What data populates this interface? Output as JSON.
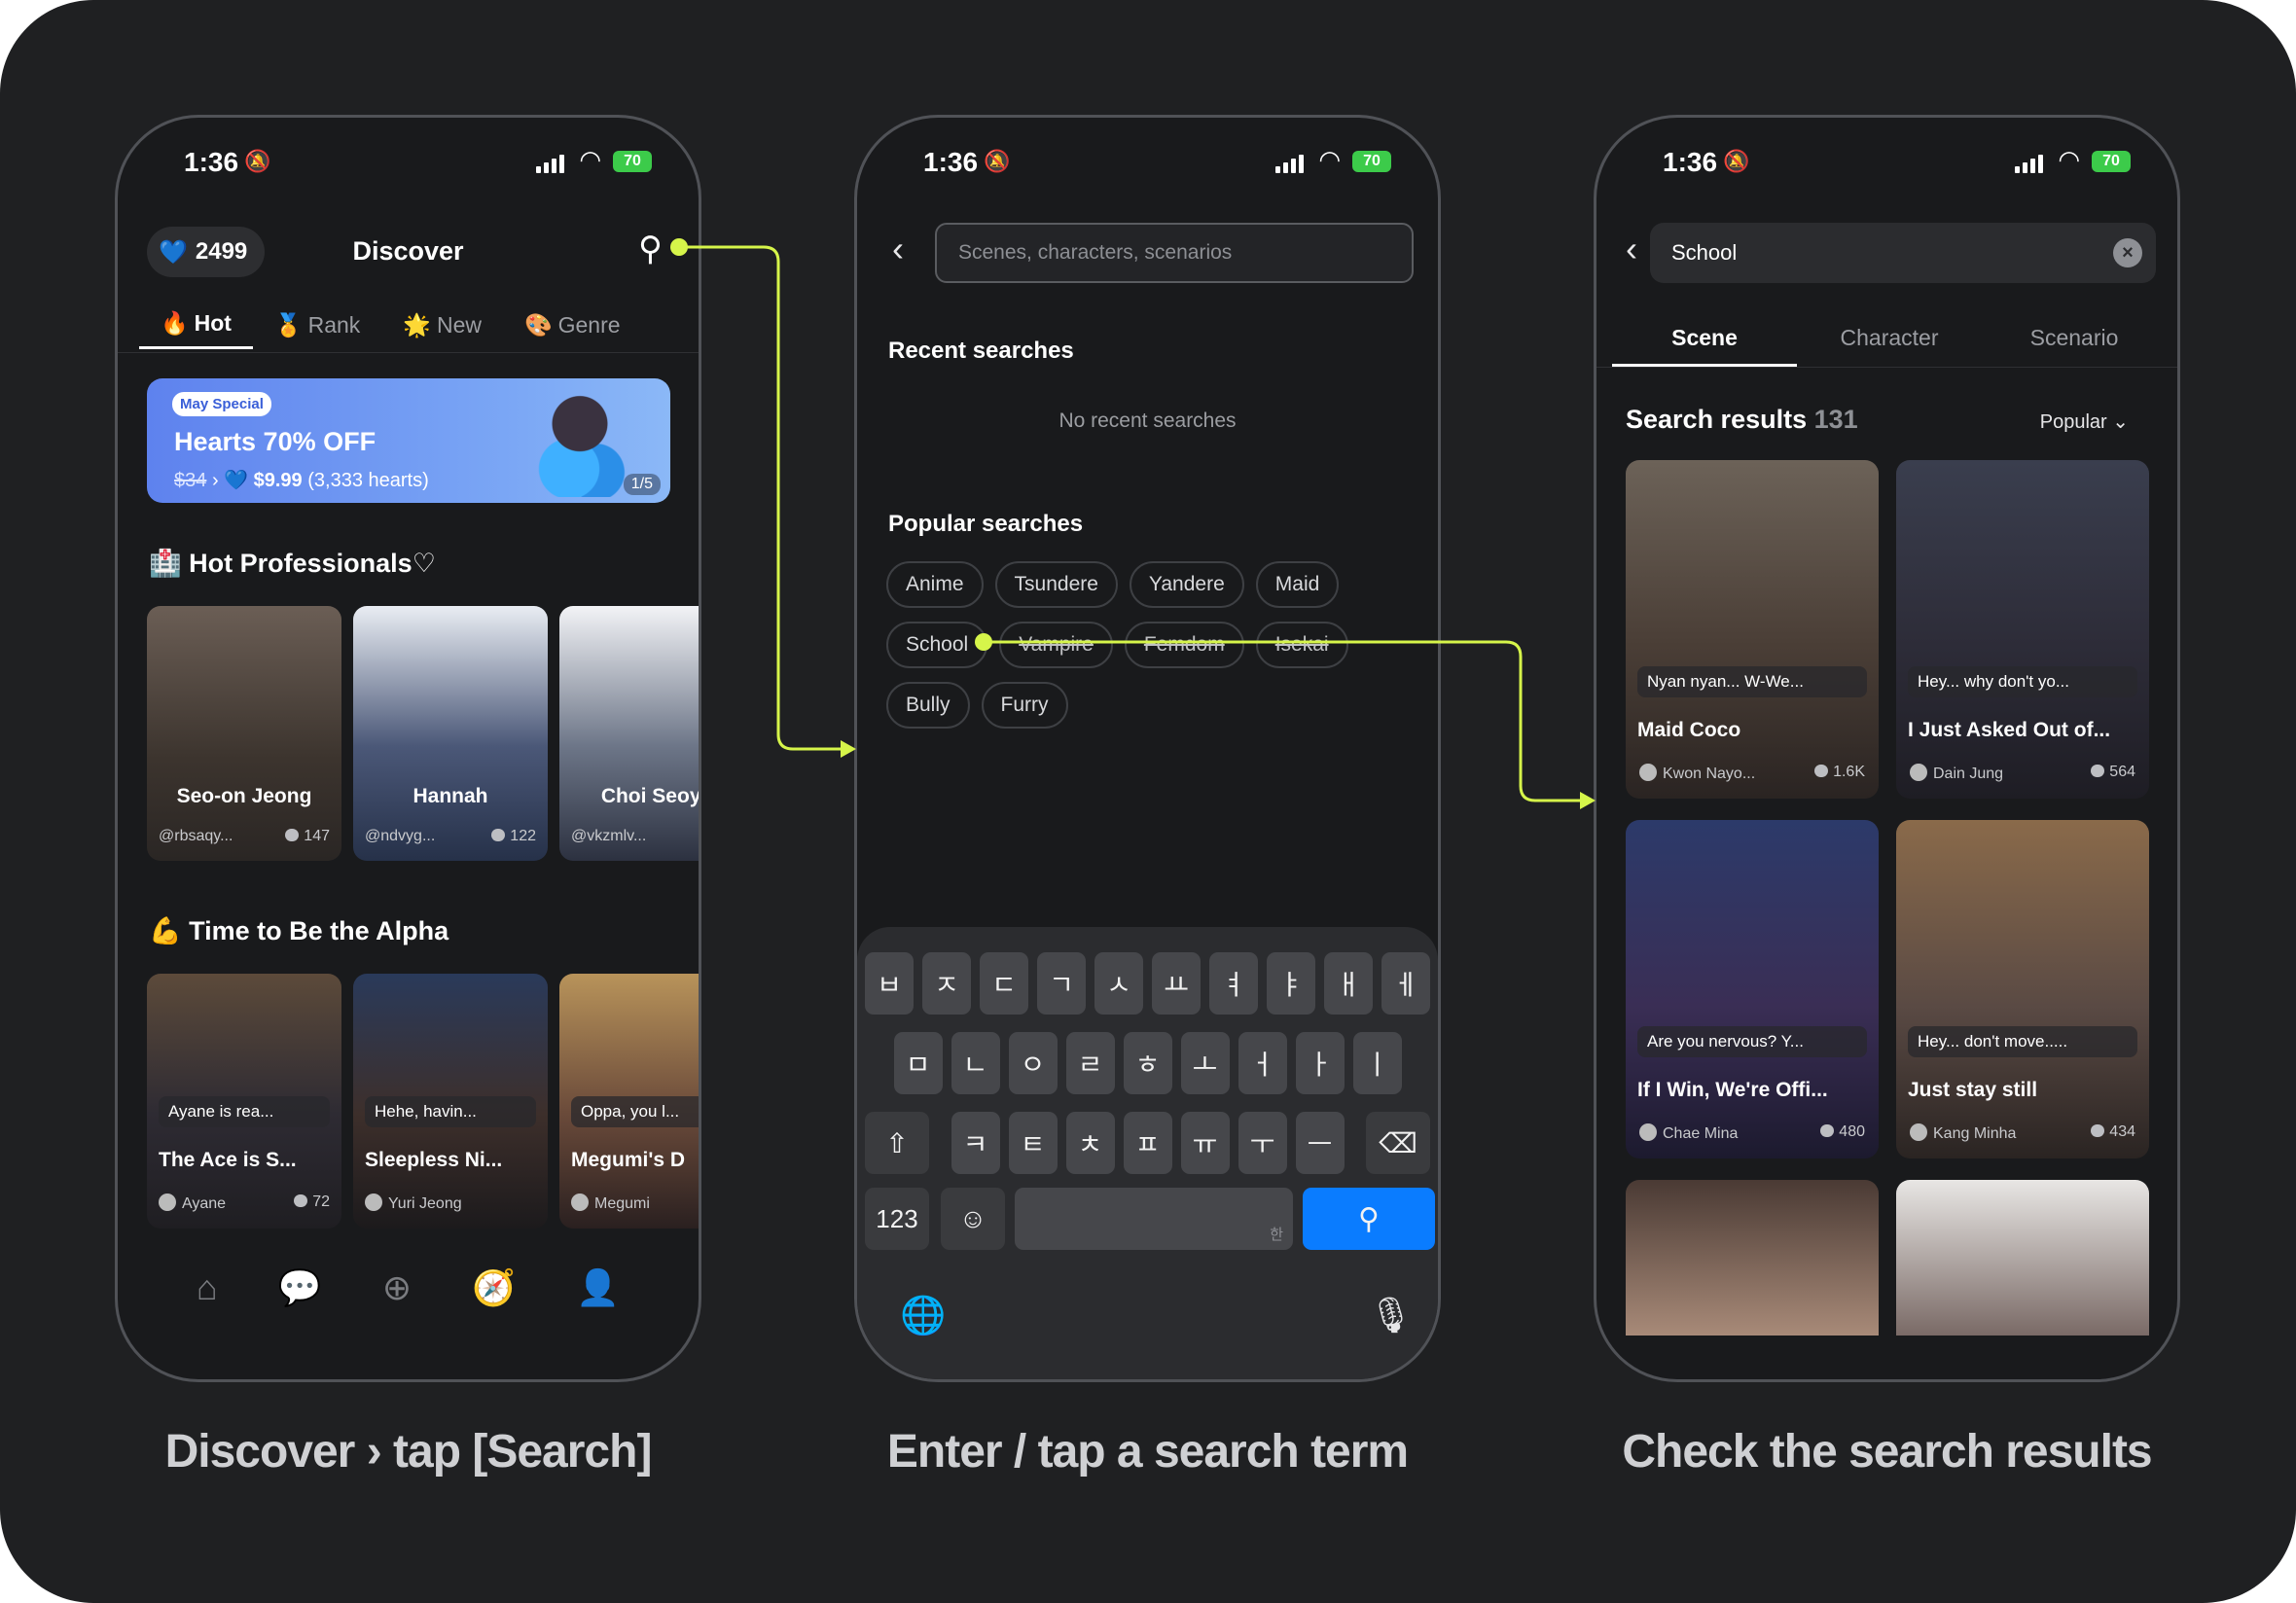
{
  "status": {
    "time": "1:36",
    "battery": "70"
  },
  "captions": {
    "step1": "Discover › tap [Search]",
    "step2": "Enter / tap a search term",
    "step3": "Check the search results"
  },
  "discover": {
    "hearts": "2499",
    "title": "Discover",
    "tabs": [
      {
        "label": "Hot",
        "icon": "🔥"
      },
      {
        "label": "Rank",
        "icon": "🏅"
      },
      {
        "label": "New",
        "icon": "🌟"
      },
      {
        "label": "Genre",
        "icon": "🎨"
      }
    ],
    "banner": {
      "tag": "May Special",
      "headline": "Hearts 70% OFF",
      "old_price": "$34",
      "new_price": "$9.99",
      "hearts_note": "(3,333 hearts)",
      "pager": "1/5"
    },
    "section1": {
      "title": "Hot Professionals♡",
      "cards": [
        {
          "name": "Seo-on Jeong",
          "handle": "@rbsaqy...",
          "count": "147"
        },
        {
          "name": "Hannah",
          "handle": "@ndvyg...",
          "count": "122"
        },
        {
          "name": "Choi Seoye",
          "handle": "@vkzmlv...",
          "count": ""
        }
      ]
    },
    "section2": {
      "title": "Time to Be the Alpha",
      "cards": [
        {
          "bubble": "Ayane is rea...",
          "title": "The Ace is S...",
          "author": "Ayane",
          "count": "72"
        },
        {
          "bubble": "Hehe, havin...",
          "title": "Sleepless Ni...",
          "author": "Yuri Jeong",
          "count": ""
        },
        {
          "bubble": "Oppa, you l...",
          "title": "Megumi's D",
          "author": "Megumi",
          "count": ""
        }
      ]
    }
  },
  "search": {
    "placeholder": "Scenes, characters, scenarios",
    "recent_title": "Recent searches",
    "recent_empty": "No recent searches",
    "popular_title": "Popular searches",
    "chips": [
      "Anime",
      "Tsundere",
      "Yandere",
      "Maid",
      "School",
      "Vampire",
      "Femdom",
      "Isekai",
      "Bully",
      "Furry"
    ],
    "keyboard": {
      "row1": [
        "ㅂ",
        "ㅈ",
        "ㄷ",
        "ㄱ",
        "ㅅ",
        "ㅛ",
        "ㅕ",
        "ㅑ",
        "ㅐ",
        "ㅔ"
      ],
      "row2": [
        "ㅁ",
        "ㄴ",
        "ㅇ",
        "ㄹ",
        "ㅎ",
        "ㅗ",
        "ㅓ",
        "ㅏ",
        "ㅣ"
      ],
      "row3": [
        "ㅋ",
        "ㅌ",
        "ㅊ",
        "ㅍ",
        "ㅠ",
        "ㅜ",
        "ㅡ"
      ],
      "numbers": "123",
      "space_hint": "한"
    }
  },
  "results": {
    "query": "School",
    "tabs": [
      "Scene",
      "Character",
      "Scenario"
    ],
    "title": "Search results",
    "count": "131",
    "sort": "Popular",
    "items": [
      {
        "bubble": "Nyan nyan... W-We...",
        "title": "Maid Coco",
        "author": "Kwon Nayo...",
        "count": "1.6K"
      },
      {
        "bubble": "Hey... why don't yo...",
        "title": "I Just Asked Out of...",
        "author": "Dain Jung",
        "count": "564"
      },
      {
        "bubble": "Are you nervous? Y...",
        "title": "If I Win, We're Offi...",
        "author": "Chae Mina",
        "count": "480"
      },
      {
        "bubble": "Hey... don't move.....",
        "title": "Just stay still",
        "author": "Kang Minha",
        "count": "434"
      }
    ]
  },
  "colors": {
    "background": "#1f2022",
    "accent_arrow": "#d6f54a",
    "search_key": "#0a7cff"
  }
}
